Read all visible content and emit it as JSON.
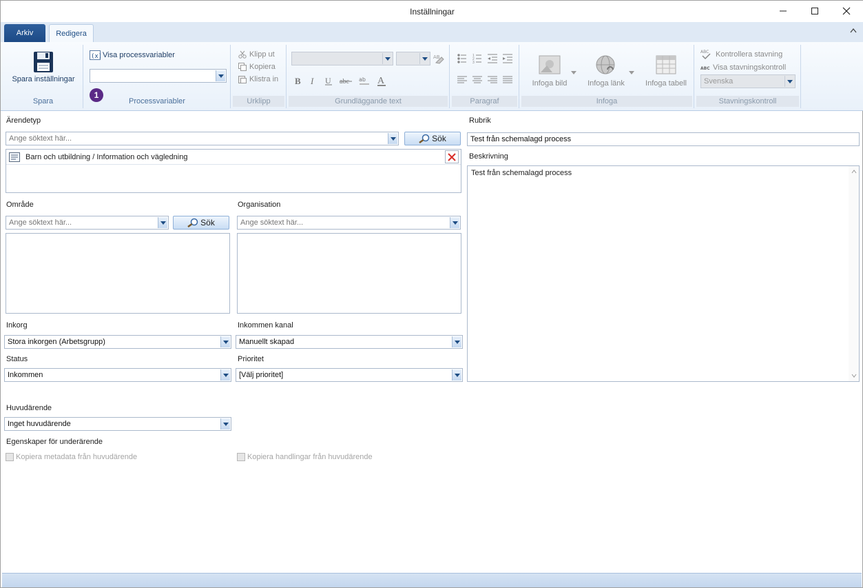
{
  "window": {
    "title": "Inställningar"
  },
  "tabs": {
    "arkiv": "Arkiv",
    "redigera": "Redigera"
  },
  "ribbon": {
    "spara": {
      "button": "Spara inställningar",
      "group": "Spara"
    },
    "processvariabler": {
      "show": "Visa processvariabler",
      "badge": "1",
      "group": "Processvariabler"
    },
    "urklipp": {
      "cut": "Klipp ut",
      "copy": "Kopiera",
      "paste": "Klistra in",
      "group": "Urklipp"
    },
    "grundlaggande": {
      "group": "Grundläggande text"
    },
    "paragraf": {
      "group": "Paragraf"
    },
    "infoga": {
      "image": "Infoga bild",
      "link": "Infoga länk",
      "table": "Infoga tabell",
      "group": "Infoga"
    },
    "stavning": {
      "check": "Kontrollera stavning",
      "show": "Visa stavningskontroll",
      "language": "Svenska",
      "group": "Stavningskontroll"
    }
  },
  "form": {
    "arendetyp": {
      "label": "Ärendetyp",
      "placeholder": "Ange söktext här...",
      "search": "Sök",
      "selected": "Barn och utbildning / Information och vägledning"
    },
    "omrade": {
      "label": "Område",
      "placeholder": "Ange söktext här...",
      "search": "Sök"
    },
    "organisation": {
      "label": "Organisation",
      "placeholder": "Ange söktext här..."
    },
    "inkorg": {
      "label": "Inkorg",
      "value": "Stora inkorgen (Arbetsgrupp)"
    },
    "kanal": {
      "label": "Inkommen kanal",
      "value": "Manuellt skapad"
    },
    "status": {
      "label": "Status",
      "value": "Inkommen"
    },
    "prioritet": {
      "label": "Prioritet",
      "value": "[Välj prioritet]"
    },
    "huvudarende": {
      "label": "Huvudärende",
      "value": "Inget huvudärende"
    },
    "egenskaper": {
      "label": "Egenskaper för underärende",
      "metadata": "Kopiera metadata från huvudärende",
      "handlingar": "Kopiera handlingar från huvudärende"
    },
    "rubrik": {
      "label": "Rubrik",
      "value": "Test från schemalagd process"
    },
    "beskrivning": {
      "label": "Beskrivning",
      "value": "Test från schemalagd process"
    }
  },
  "colors": {
    "accent": "#1f4e85",
    "tab_active": "#2e5f9c",
    "ribbon_bg": "#e9f1fa",
    "badge": "#5b2a86",
    "delete_red": "#d9302b"
  }
}
